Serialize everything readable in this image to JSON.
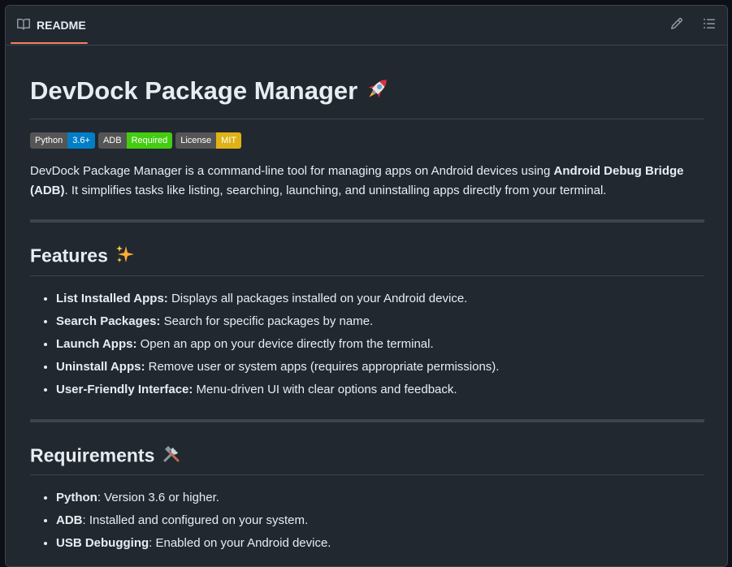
{
  "header": {
    "tab_label": "README",
    "icons": [
      "book-icon",
      "pencil-icon",
      "list-icon"
    ]
  },
  "title": {
    "text": "DevDock Package Manager",
    "emoji": "rocket"
  },
  "badges": [
    {
      "label": "Python",
      "value": "3.6+",
      "color": "#007ec6"
    },
    {
      "label": "ADB",
      "value": "Required",
      "color": "#4c1"
    },
    {
      "label": "License",
      "value": "MIT",
      "color": "#dfb317"
    }
  ],
  "intro": {
    "before": "DevDock Package Manager is a command-line tool for managing apps on Android devices using ",
    "bold": "Android Debug Bridge (ADB)",
    "after": ". It simplifies tasks like listing, searching, launching, and uninstalling apps directly from your terminal."
  },
  "features": {
    "heading": "Features",
    "emoji": "sparkles",
    "items": [
      {
        "term": "List Installed Apps:",
        "desc": " Displays all packages installed on your Android device."
      },
      {
        "term": "Search Packages:",
        "desc": " Search for specific packages by name."
      },
      {
        "term": "Launch Apps:",
        "desc": " Open an app on your device directly from the terminal."
      },
      {
        "term": "Uninstall Apps:",
        "desc": " Remove user or system apps (requires appropriate permissions)."
      },
      {
        "term": "User-Friendly Interface:",
        "desc": " Menu-driven UI with clear options and feedback."
      }
    ]
  },
  "requirements": {
    "heading": "Requirements",
    "emoji": "hammer-and-wrench",
    "items": [
      {
        "term": "Python",
        "desc": ": Version 3.6 or higher."
      },
      {
        "term": "ADB",
        "desc": ": Installed and configured on your system."
      },
      {
        "term": "USB Debugging",
        "desc": ": Enabled on your Android device."
      }
    ]
  },
  "colors": {
    "background": "#0d1117",
    "panel": "#212830",
    "border": "#3d444d",
    "text": "#e6edf3",
    "muted": "#9198a1",
    "accent": "#f78166"
  }
}
